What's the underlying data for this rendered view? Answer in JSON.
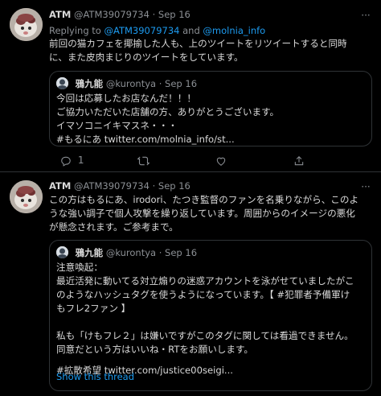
{
  "tweet1": {
    "display_name": "ATM",
    "handle": "@ATM39079734",
    "dot": "·",
    "date": "Sep 16",
    "more": "···",
    "replying_prefix": "Replying to",
    "replying_to_1": "@ATM39079734",
    "replying_and": "and",
    "replying_to_2": "@molnia_info",
    "text_line1": "前回の猫カフェを揶揄した人も、上のツイートをリツイートすると同時",
    "text_line2": "に、また皮肉まじりのツイートをしています。",
    "quote": {
      "display_name": "鴉九能",
      "handle": "@kurontya",
      "dot": "·",
      "date": "Sep 16",
      "line1": "今回は応募したお店なんだ！！！",
      "line2": "ご協力いただいた店舗の方、ありがとうございます。",
      "line3": "イマソコニイキマスネ・・・",
      "line4": "#もるにあ twitter.com/molnia_info/st..."
    },
    "actions": {
      "reply_count": "1",
      "retweet_icon": "retweet-icon",
      "like_icon": "heart-icon",
      "share_icon": "share-icon"
    }
  },
  "tweet2": {
    "display_name": "ATM",
    "handle": "@ATM39079734",
    "dot": "·",
    "date": "Sep 16",
    "more": "···",
    "text_line1": "この方はもるにあ、irodori、たつき監督のファンを名乗りながら、このよ",
    "text_line2": "うな強い調子で個人攻撃を繰り返しています。周囲からのイメージの悪化",
    "text_line3": "が懸念されます。ご参考まで。",
    "quote": {
      "display_name": "鴉九能",
      "handle": "@kurontya",
      "dot": "·",
      "date": "Sep 16",
      "line1": "注意喚起：",
      "line2": "最近活発に動いてる対立煽りの迷惑アカウントを泳がせていましたがこ",
      "line3": "のようなハッシュタグを使うようになっています。【 #犯罪者予備軍け",
      "line4": "もフレ2ファン 】",
      "line5": "私も「けもフレ２」は嫌いですがこのタグに関しては看過できません。",
      "line6": "同意だという方はいいね・RTをお願いします。",
      "line7": "#拡散希望 twitter.com/justice00seigi...",
      "show_thread": "Show this thread"
    }
  },
  "colors": {
    "background": "#000000",
    "text": "#d9d9d9",
    "muted": "#8b8f94",
    "link": "#1d9bf0",
    "border": "#2f3336"
  }
}
